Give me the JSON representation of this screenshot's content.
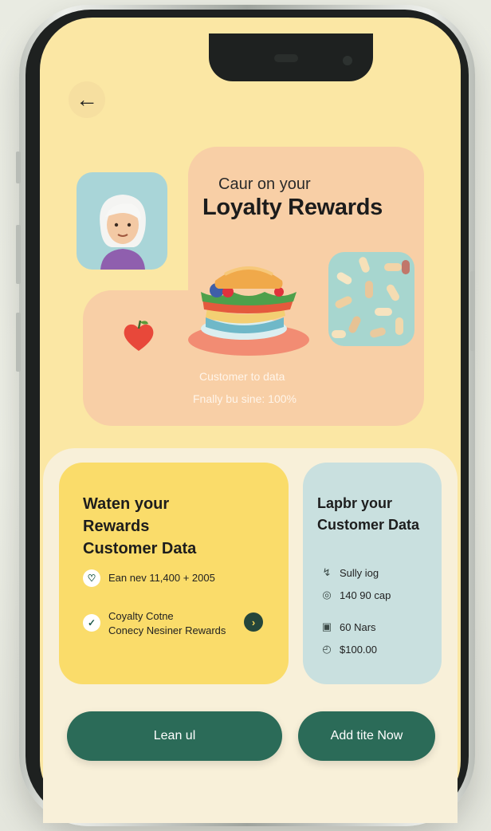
{
  "header": {
    "back_icon": "arrow-left-icon",
    "back_glyph": "←"
  },
  "hero": {
    "subtitle": "Caur on your",
    "title": "Loyalty Rewards",
    "caption_1": "Customer to data",
    "caption_2": "Fnally bu sine: 100%"
  },
  "rewards_card": {
    "title_line_1": "Waten your",
    "title_line_2": "Rewards",
    "title_line_3": "Customer Data",
    "row_1": {
      "icon": "heart-circle-icon",
      "glyph": "♡",
      "text": "Ean nev 11,400 + 2005"
    },
    "row_2": {
      "icon": "check-circle-icon",
      "glyph": "✓",
      "text_line_1": "Coyalty Cotne",
      "text_line_2": "Conecy Nesiner Rewards"
    },
    "go_glyph": "›"
  },
  "data_card": {
    "title_line_1": "Lapbr your",
    "title_line_2": "Customer Data",
    "stats": [
      {
        "icon": "chart-icon",
        "glyph": "↯",
        "text": "Sully iog"
      },
      {
        "icon": "coin-icon",
        "glyph": "◎",
        "text": "140 90 cap"
      },
      {
        "icon": "calendar-icon",
        "glyph": "▣",
        "text": "60 Nars"
      },
      {
        "icon": "clock-icon",
        "glyph": "◴",
        "text": "$100.00"
      }
    ]
  },
  "actions": {
    "learn_label": "Lean ul",
    "add_label": "Add tite Now"
  },
  "colors": {
    "screen_bg": "#fbe7a4",
    "hero_peach": "#f8cfa6",
    "card_yellow": "#fadc6a",
    "card_teal": "#c9e0df",
    "button_green": "#2b6b58"
  }
}
